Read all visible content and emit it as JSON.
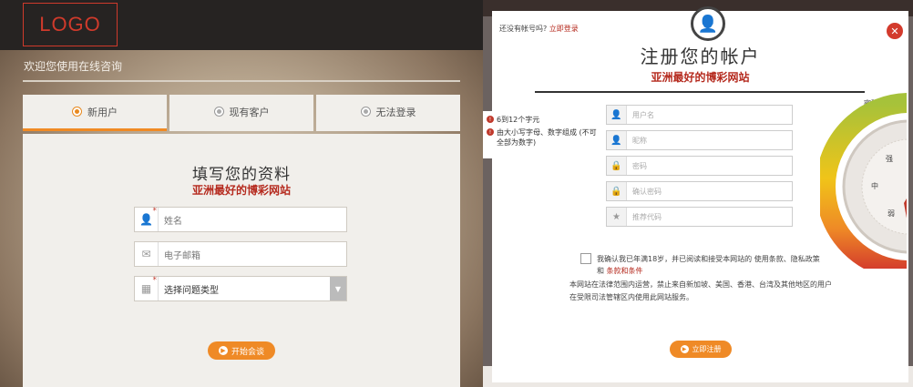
{
  "left": {
    "logo": "LOGO",
    "welcome": "欢迎您使用在线咨询",
    "tabs": [
      {
        "label": "新用户",
        "active": true
      },
      {
        "label": "现有客户",
        "active": false
      },
      {
        "label": "无法登录",
        "active": false
      }
    ],
    "form_title": "填写您的资料",
    "form_subtitle": "亚洲最好的博彩网站",
    "fields": {
      "name_placeholder": "姓名",
      "email_placeholder": "电子邮箱",
      "problem_select": "选择问题类型"
    },
    "start_button": "开始会谈"
  },
  "right": {
    "have_account": "还没有帐号吗?",
    "login_link": "立即登录",
    "title": "注册您的帐户",
    "subtitle": "亚洲最好的博彩网站",
    "hints": [
      "6到12个字元",
      "由大小写字母、数字组成 (不可全部为数字)"
    ],
    "fields": [
      {
        "icon": "user-icon",
        "placeholder": "用户名"
      },
      {
        "icon": "user-icon",
        "placeholder": "昵称"
      },
      {
        "icon": "lock-icon",
        "placeholder": "密码"
      },
      {
        "icon": "lock-icon",
        "placeholder": "确认密码"
      },
      {
        "icon": "star-icon",
        "placeholder": "推荐代码"
      }
    ],
    "strength_label": "密码强度",
    "strength_marks": [
      "强",
      "中",
      "弱"
    ],
    "agree_text": "我确认我已年满18岁，并已阅读和接受本网站的 使用条款、隐私政策和",
    "agree_link": "条款和条件",
    "note_text": "本网站在法律范围内运营，禁止来自新加坡、美国、香港、台湾及其他地区的用户在受限司法管辖区内使用此网站服务。",
    "register_button": "立即注册",
    "colors": {
      "accent": "#ef8a26",
      "brand_red": "#b52a1e",
      "close_red": "#d33a2c"
    }
  }
}
